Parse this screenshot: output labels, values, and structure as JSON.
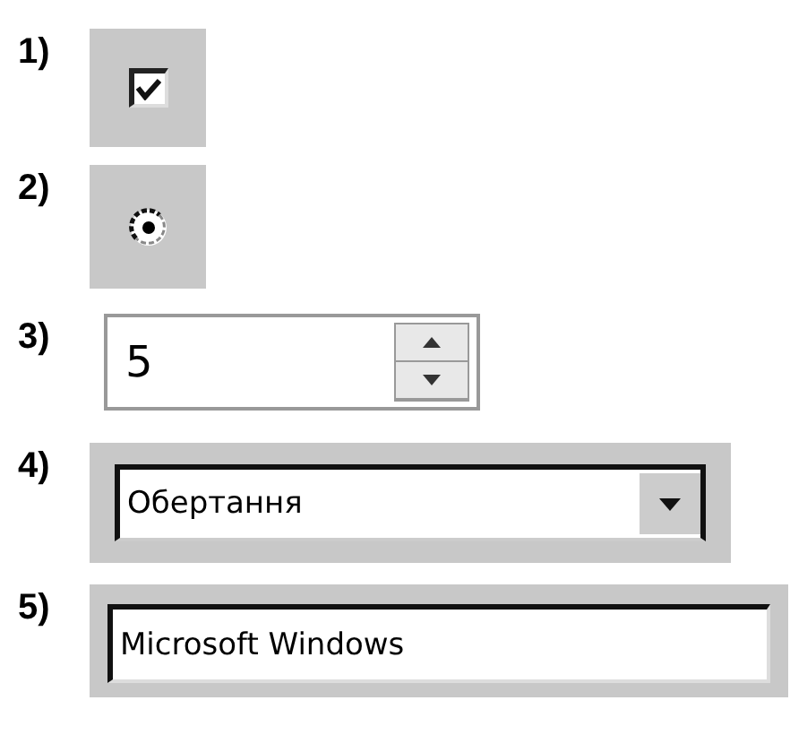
{
  "items": [
    {
      "number": "1)",
      "kind": "checkbox",
      "checked": true
    },
    {
      "number": "2)",
      "kind": "radio",
      "selected": true
    },
    {
      "number": "3)",
      "kind": "spinner",
      "value": "5"
    },
    {
      "number": "4)",
      "kind": "combo",
      "value": "Обертання"
    },
    {
      "number": "5)",
      "kind": "text",
      "value": "Microsoft Windows"
    }
  ]
}
